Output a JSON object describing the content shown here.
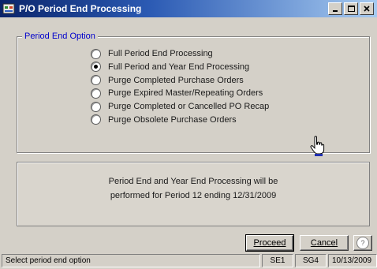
{
  "window": {
    "title": "P/O Period End Processing",
    "controls": [
      "minimize-icon",
      "maximize-icon",
      "close-icon"
    ]
  },
  "options_group": {
    "legend": "Period End Option",
    "selected_index": 1,
    "options": [
      {
        "label": "Full Period End Processing"
      },
      {
        "label": "Full Period and Year End Processing"
      },
      {
        "label": "Purge Completed Purchase Orders"
      },
      {
        "label": "Purge Expired Master/Repeating Orders"
      },
      {
        "label": "Purge Completed or Cancelled PO Recap"
      },
      {
        "label": "Purge Obsolete Purchase Orders"
      }
    ]
  },
  "message": {
    "line1": "Period End and Year End Processing will be",
    "line2": "performed for Period 12 ending 12/31/2009"
  },
  "buttons": {
    "proceed": "Proceed",
    "cancel": "Cancel",
    "help": "?"
  },
  "status": {
    "message": "Select period end option",
    "company": "SE1",
    "user": "SG4",
    "date": "10/13/2009"
  },
  "colors": {
    "title_bar_start": "#0a246a",
    "title_bar_end": "#a6caf0",
    "legend_text": "#0000cc",
    "face": "#d4d0c8"
  }
}
